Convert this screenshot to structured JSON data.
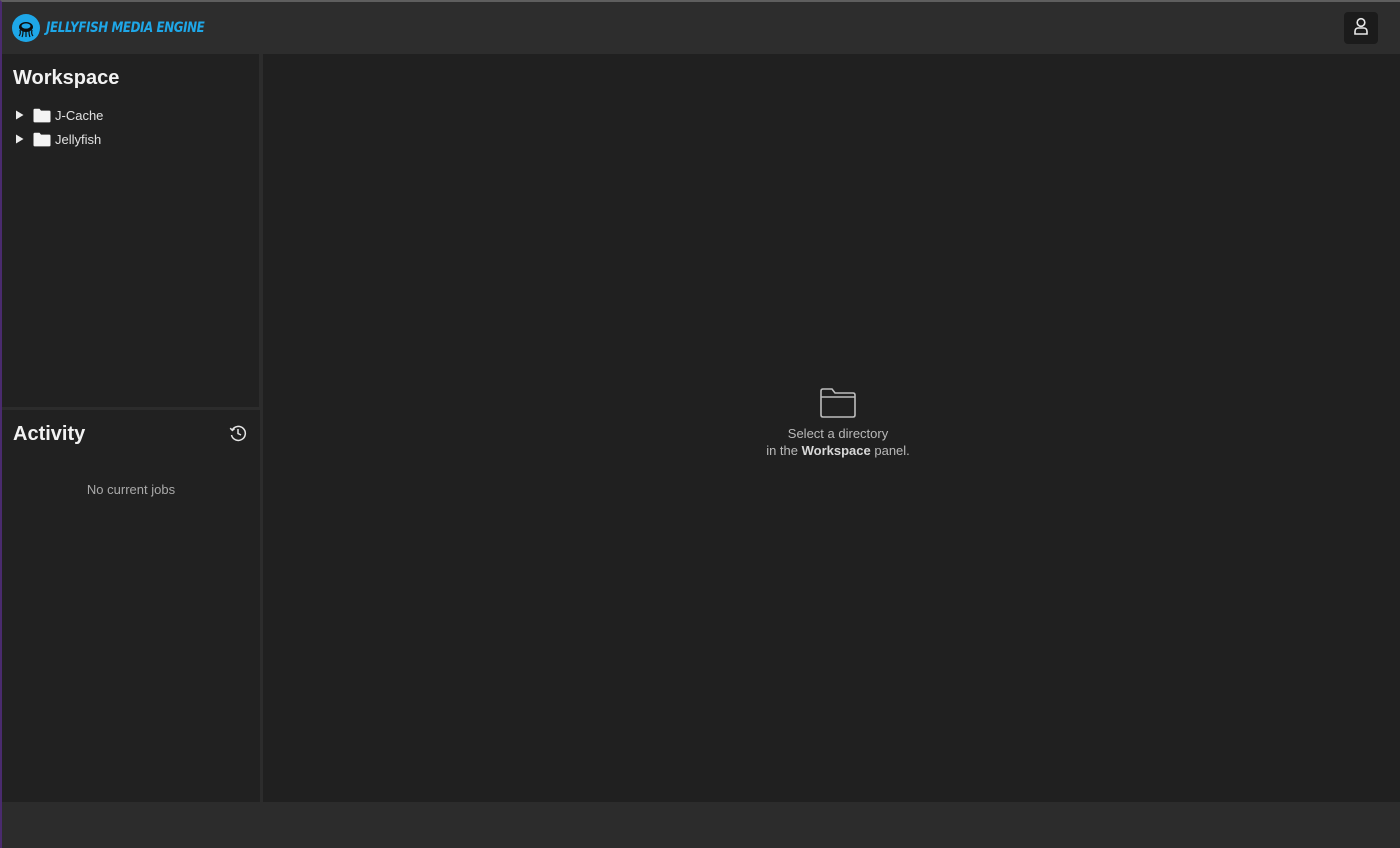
{
  "header": {
    "brand_name": "JELLYFISH MEDIA ENGINE",
    "brand_color": "#1ea7e8",
    "user_icon": "user-icon"
  },
  "workspace": {
    "title": "Workspace",
    "items": [
      {
        "label": "J-Cache",
        "icon": "folder-icon"
      },
      {
        "label": "Jellyfish",
        "icon": "folder-icon"
      }
    ]
  },
  "activity": {
    "title": "Activity",
    "history_icon": "history-icon",
    "empty_text": "No current jobs"
  },
  "main": {
    "empty_line1": "Select a directory",
    "empty_line2_prefix": "in the ",
    "empty_line2_bold": "Workspace",
    "empty_line2_suffix": " panel."
  }
}
